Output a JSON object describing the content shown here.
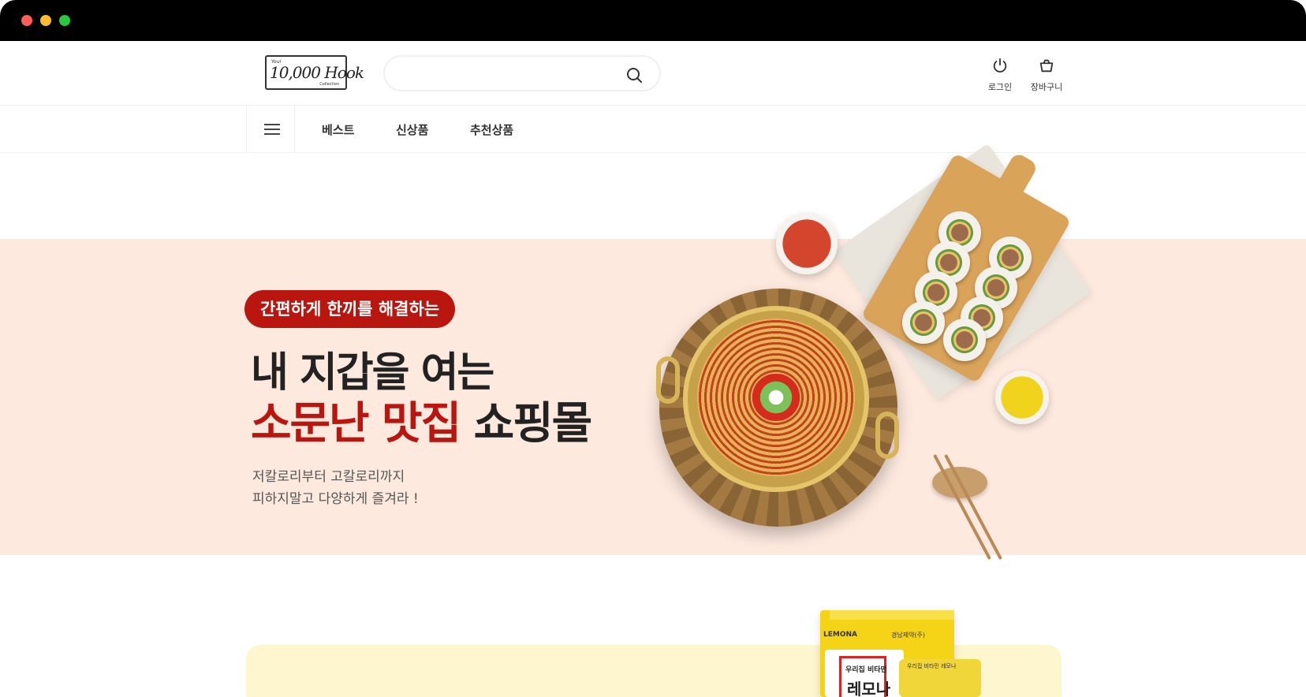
{
  "brand": {
    "logo_top": "Your",
    "logo_main": "10,000 Hook",
    "logo_bottom": "Collection"
  },
  "search": {
    "placeholder": ""
  },
  "header_actions": {
    "login": {
      "label": "로그인",
      "icon": "power-icon"
    },
    "cart": {
      "label": "장바구니",
      "icon": "basket-icon"
    }
  },
  "nav": {
    "menu_icon": "hamburger-menu-icon",
    "items": [
      {
        "label": "베스트"
      },
      {
        "label": "신상품"
      },
      {
        "label": "추천상품"
      }
    ]
  },
  "hero": {
    "badge": "간편하게 한끼를 해결하는",
    "line1": "내 지갑을 여는",
    "line2_highlight": "소문난 맛집",
    "line2_rest": " 쇼핑몰",
    "sub1": "저칼로리부터 고칼로리까지",
    "sub2": "피하지말고 다양하게 즐겨라 !"
  },
  "promo": {
    "brand": "LEMONA",
    "box_sub": "경남제약(주)",
    "house_text1": "우리집 비타민",
    "house_text2": "레모나",
    "blister_text": "우리집 비타민 레모나"
  },
  "colors": {
    "accent": "#b8160f",
    "hero_bg": "#fde9de",
    "promo_bg": "#fdf6cf"
  }
}
